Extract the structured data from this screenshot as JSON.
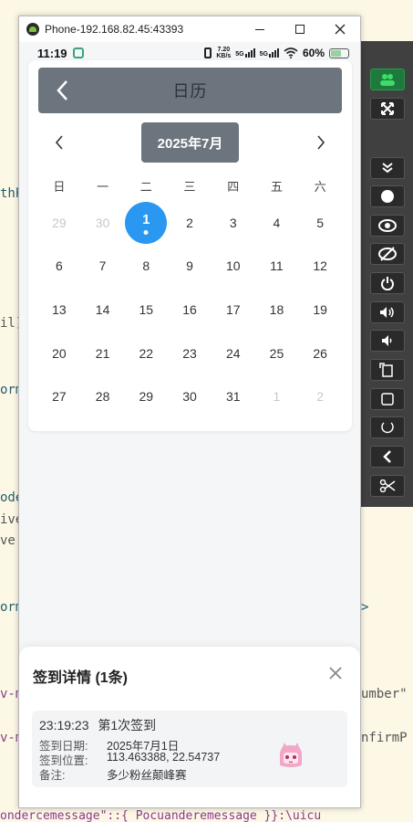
{
  "window": {
    "title": "Phone-192.168.82.45:43393"
  },
  "status_bar": {
    "time": "11:19",
    "speed_value": "7.20",
    "speed_unit": "KB/s",
    "network1": "5G",
    "network2": "5G",
    "battery": "60%",
    "battery_level": 0.6
  },
  "calendar": {
    "title": "日历",
    "month_label": "2025年7月",
    "weekdays": [
      "日",
      "一",
      "二",
      "三",
      "四",
      "五",
      "六"
    ],
    "weeks": [
      [
        {
          "d": "29",
          "muted": true
        },
        {
          "d": "30",
          "muted": true
        },
        {
          "d": "1",
          "selected": true
        },
        {
          "d": "2"
        },
        {
          "d": "3"
        },
        {
          "d": "4"
        },
        {
          "d": "5"
        }
      ],
      [
        {
          "d": "6"
        },
        {
          "d": "7"
        },
        {
          "d": "8"
        },
        {
          "d": "9"
        },
        {
          "d": "10"
        },
        {
          "d": "11"
        },
        {
          "d": "12"
        }
      ],
      [
        {
          "d": "13"
        },
        {
          "d": "14"
        },
        {
          "d": "15"
        },
        {
          "d": "16"
        },
        {
          "d": "17"
        },
        {
          "d": "18"
        },
        {
          "d": "19"
        }
      ],
      [
        {
          "d": "20"
        },
        {
          "d": "21"
        },
        {
          "d": "22"
        },
        {
          "d": "23"
        },
        {
          "d": "24"
        },
        {
          "d": "25"
        },
        {
          "d": "26"
        }
      ],
      [
        {
          "d": "27"
        },
        {
          "d": "28"
        },
        {
          "d": "29"
        },
        {
          "d": "30"
        },
        {
          "d": "31"
        },
        {
          "d": "1",
          "muted": true
        },
        {
          "d": "2",
          "muted": true
        }
      ]
    ]
  },
  "details": {
    "title": "签到详情 (1条)",
    "record": {
      "time": "23:19:23",
      "sequence": "第1次签到",
      "date_label": "签到日期:",
      "date": "2025年7月1日",
      "location_label": "签到位置:",
      "location": "113.463388, 22.54737",
      "remark_label": "备注:",
      "remark": "多少粉丝颠峰赛"
    }
  },
  "background_code": [
    "thP",
    "il]",
    "orm",
    "ode",
    "ive",
    "ve'",
    "orm",
    ">",
    "v-m",
    "umber\"",
    "v-m",
    "nfirmP",
    "ondercemessage\"::{ Pocuanderemessage }}:\\uicu"
  ]
}
